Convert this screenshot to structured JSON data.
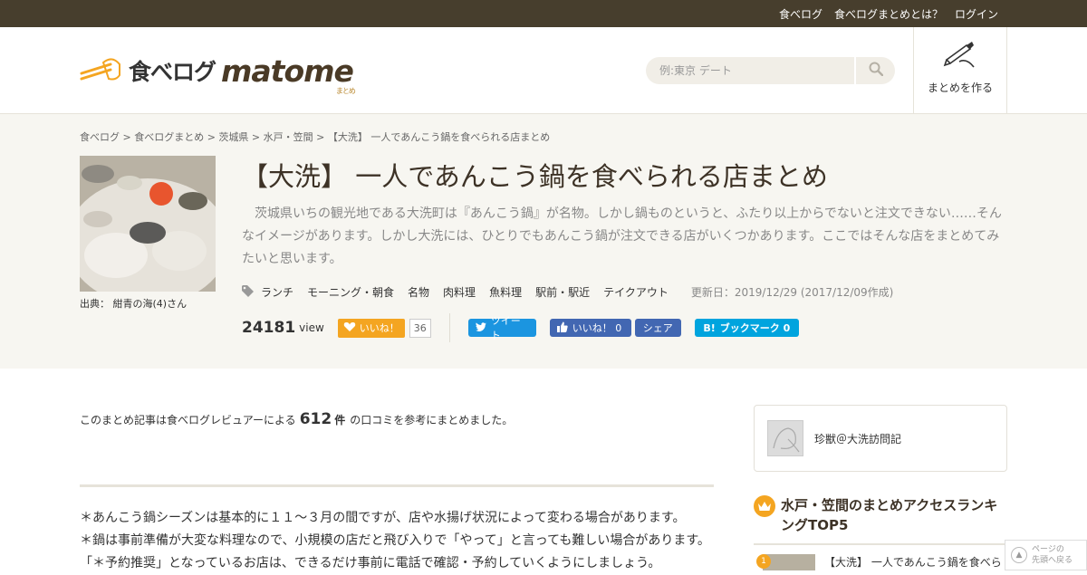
{
  "topbar": {
    "links": [
      "食べログ",
      "食べログまとめとは？",
      "ログイン"
    ]
  },
  "header": {
    "logo_jp": "食べログ",
    "logo_en": "matome",
    "logo_sub": "まとめ",
    "search_placeholder": "例:東京 デート",
    "create_label": "まとめを作る"
  },
  "breadcrumb": "食べログ > 食べログまとめ > 茨城県 > 水戸・笠間 > 【大洗】 一人であんこう鍋を食べられる店まとめ",
  "article": {
    "credit": "出典：  紺青の海(4)さん",
    "title": "【大洗】 一人であんこう鍋を食べられる店まとめ",
    "description": "茨城県いちの観光地である大洗町は『あんこう鍋』が名物。しかし鍋ものというと、ふたり以上からでないと注文できない……そんなイメージがあります。しかし大洗には、ひとりでもあんこう鍋が注文できる店がいくつかあります。ここではそんな店をまとめてみたいと思います。",
    "tags": [
      "ランチ",
      "モーニング・朝食",
      "名物",
      "肉料理",
      "魚料理",
      "駅前・駅近",
      "テイクアウト"
    ],
    "updated": "更新日：2019/12/29 (2017/12/09作成)",
    "views": "24181",
    "views_unit": "view",
    "iine_label": "いいね！",
    "iine_count": "36",
    "tweet_label": "ツイート",
    "fb_like_label": "いいね！ 0",
    "fb_share_label": "シェア",
    "hatena_label": "ブックマーク  0"
  },
  "intro": {
    "prefix": "このまとめ記事は食べログレビュアーによる",
    "count": "612",
    "unit": "件",
    "suffix": "の口コミを参考にまとめました。"
  },
  "notes": [
    "＊あんこう鍋シーズンは基本的に１１～３月の間ですが、店や水揚げ状況によって変わる場合があります。",
    "＊鍋は事前準備が大変な料理なので、小規模の店だと飛び入りで「やって」と言っても難しい場合があります。",
    "「＊予約推奨」となっているお店は、できるだけ事前に電話で確認・予約していくようにしましょう。"
  ],
  "sidebar": {
    "author_name": "珍獣＠大洗訪問記",
    "ranking_title": "水戸・笠間のまとめアクセスランキングTOP5",
    "ranking_items": [
      {
        "rank": "1",
        "title": "【大洗】 一人であんこう鍋を食べら"
      }
    ]
  },
  "pagetop": {
    "line1": "ページの",
    "line2": "先頭へ戻る"
  },
  "colors": {
    "topbar": "#473e2d",
    "accent": "#f4a521",
    "hero_bg": "#f7f6f1",
    "twitter": "#1b95e0",
    "facebook": "#4267b2",
    "hatena": "#00a4de"
  }
}
